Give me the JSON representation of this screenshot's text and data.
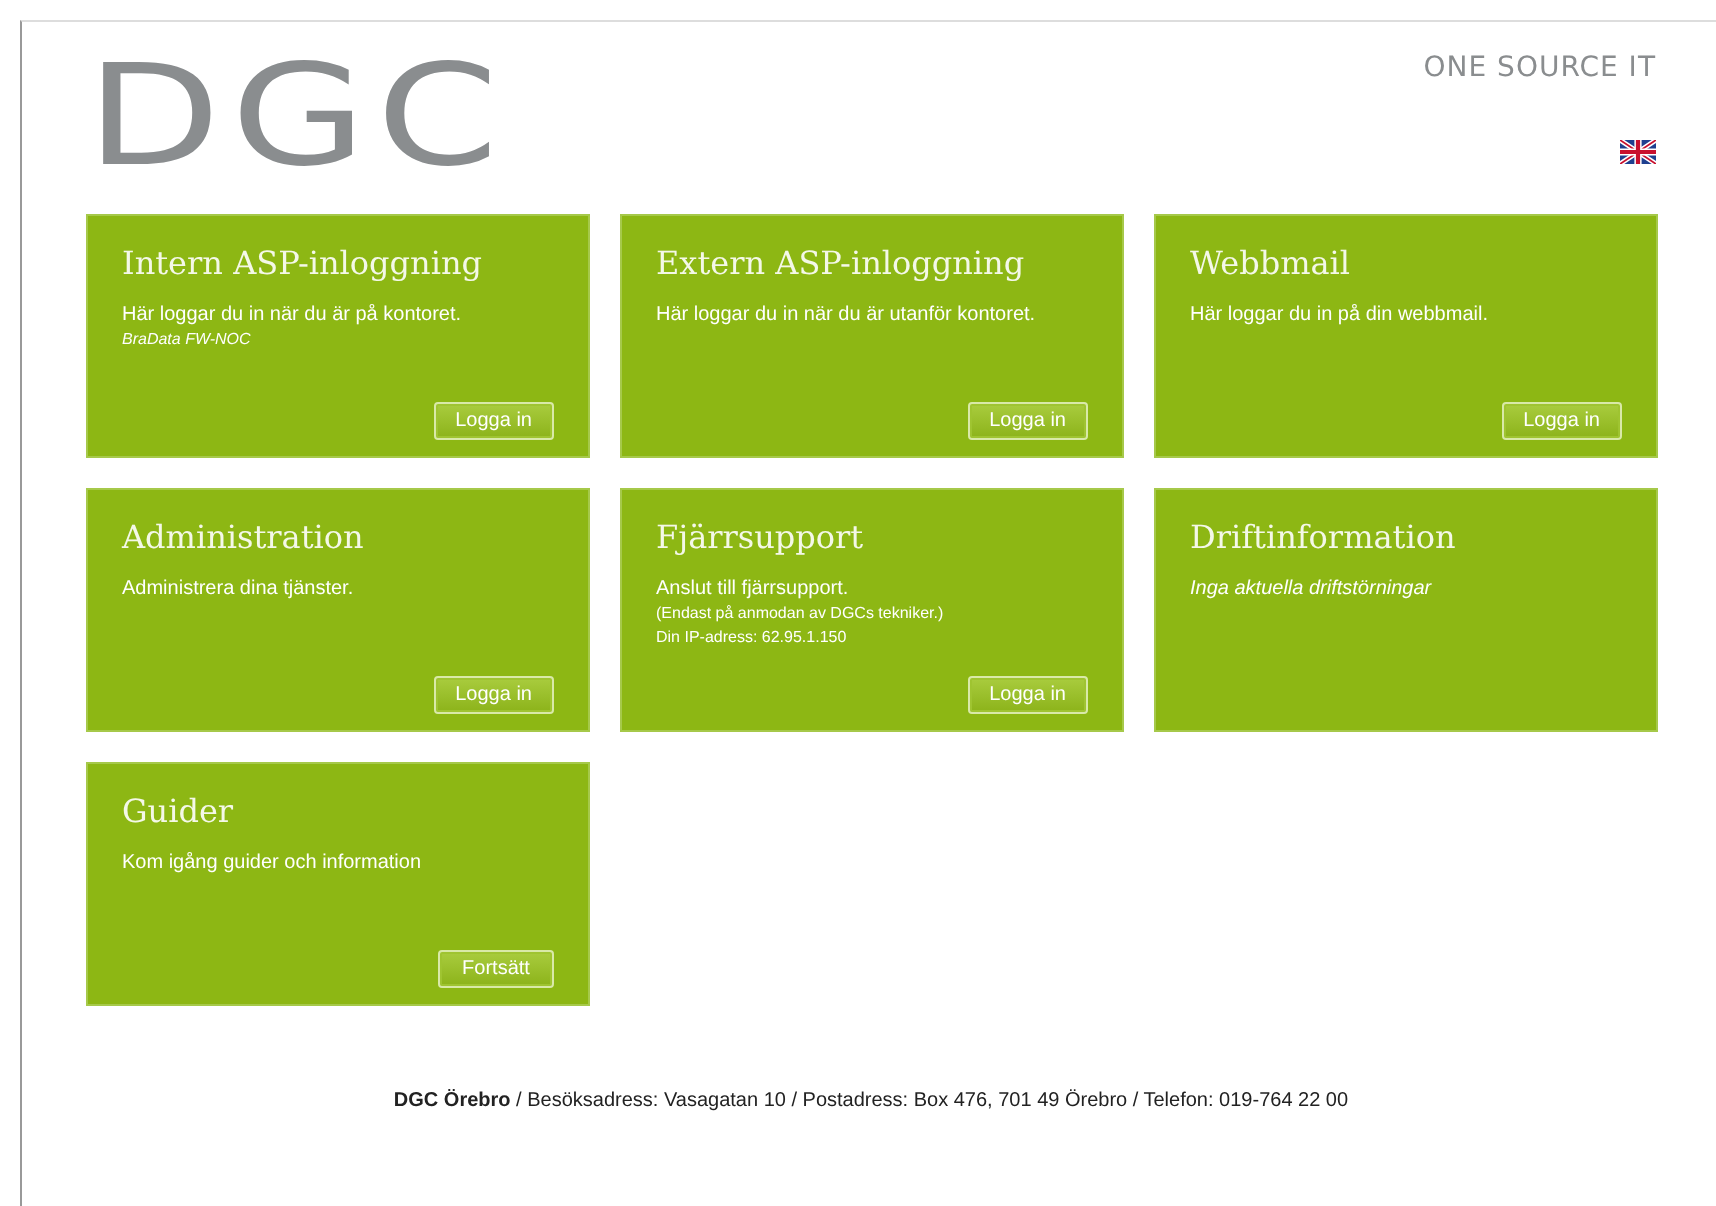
{
  "header": {
    "logo": "DGC",
    "tagline": "ONE SOURCE IT"
  },
  "cards": [
    {
      "title": "Intern ASP-inloggning",
      "lines": [
        {
          "kind": "text",
          "text": "Här loggar du in när du är på kontoret."
        },
        {
          "kind": "note",
          "text": "BraData FW-NOC"
        }
      ],
      "button": "Logga in"
    },
    {
      "title": "Extern ASP-inloggning",
      "lines": [
        {
          "kind": "text",
          "text": "Här loggar du in när du är utanför kontoret."
        }
      ],
      "button": "Logga in"
    },
    {
      "title": "Webbmail",
      "lines": [
        {
          "kind": "text",
          "text": "Här loggar du in på din webbmail."
        }
      ],
      "button": "Logga in"
    },
    {
      "title": "Administration",
      "lines": [
        {
          "kind": "text",
          "text": "Administrera dina tjänster."
        }
      ],
      "button": "Logga in"
    },
    {
      "title": "Fjärrsupport",
      "lines": [
        {
          "kind": "text",
          "text": "Anslut till fjärrsupport."
        },
        {
          "kind": "small",
          "text": "(Endast på anmodan av DGCs tekniker.)"
        },
        {
          "kind": "small",
          "text": "Din IP-adress: 62.95.1.150"
        }
      ],
      "button": "Logga in"
    },
    {
      "title": "Driftinformation",
      "lines": [
        {
          "kind": "italic",
          "text": "Inga aktuella driftstörningar"
        }
      ]
    },
    {
      "title": "Guider",
      "lines": [
        {
          "kind": "text",
          "text": "Kom igång guider och information"
        }
      ],
      "button": "Fortsätt"
    }
  ],
  "footer": "**DGC Örebro** / Besöksadress: Vasagatan 10 / Postadress: Box 476, 701 49 Örebro / Telefon: 019-764 22 00"
}
